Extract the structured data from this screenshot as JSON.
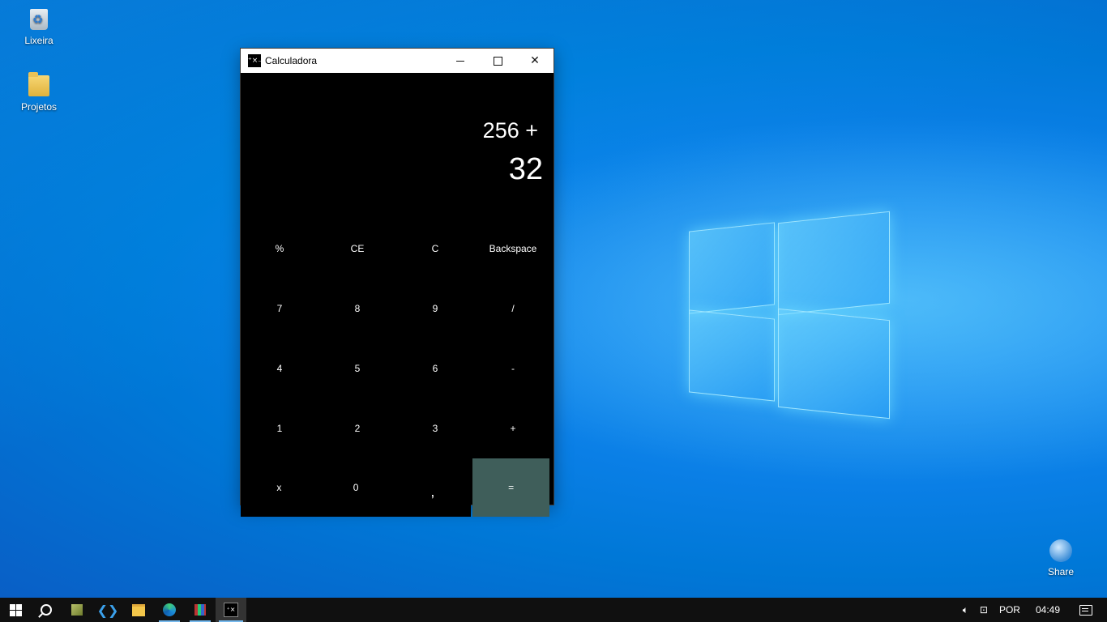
{
  "desktop": {
    "icons": [
      {
        "label": "Lixeira",
        "icon": "recycle-bin-icon"
      },
      {
        "label": "Projetos",
        "icon": "folder-icon"
      },
      {
        "label": "Share",
        "icon": "network-share-icon"
      }
    ]
  },
  "window": {
    "title": "Calculadora",
    "app_icon_glyph": "⁺×₋%",
    "controls": {
      "minimize": "minimize",
      "maximize": "maximize",
      "close": "✕"
    }
  },
  "display": {
    "expression": "256 +",
    "value": "32"
  },
  "keypad": {
    "rows": [
      [
        "%",
        "CE",
        "C",
        "Backspace"
      ],
      [
        "7",
        "8",
        "9",
        "/"
      ],
      [
        "4",
        "5",
        "6",
        "-"
      ],
      [
        "1",
        "2",
        "3",
        "+"
      ],
      [
        "x",
        "0",
        ",",
        "="
      ]
    ]
  },
  "taskbar": {
    "apps": [
      "start-icon",
      "search-icon",
      "minecraft-icon",
      "vscode-icon",
      "file-explorer-icon",
      "edge-icon",
      "winrar-icon",
      "calculator-icon"
    ],
    "tray": {
      "volume": "volume-icon",
      "network": "network-icon",
      "language": "POR",
      "time": "04:49",
      "notifications": "action-center-icon"
    }
  },
  "colors": {
    "equals_bg": "#3f5e5a",
    "taskbar_bg": "#101010",
    "calc_bg": "#000000"
  }
}
